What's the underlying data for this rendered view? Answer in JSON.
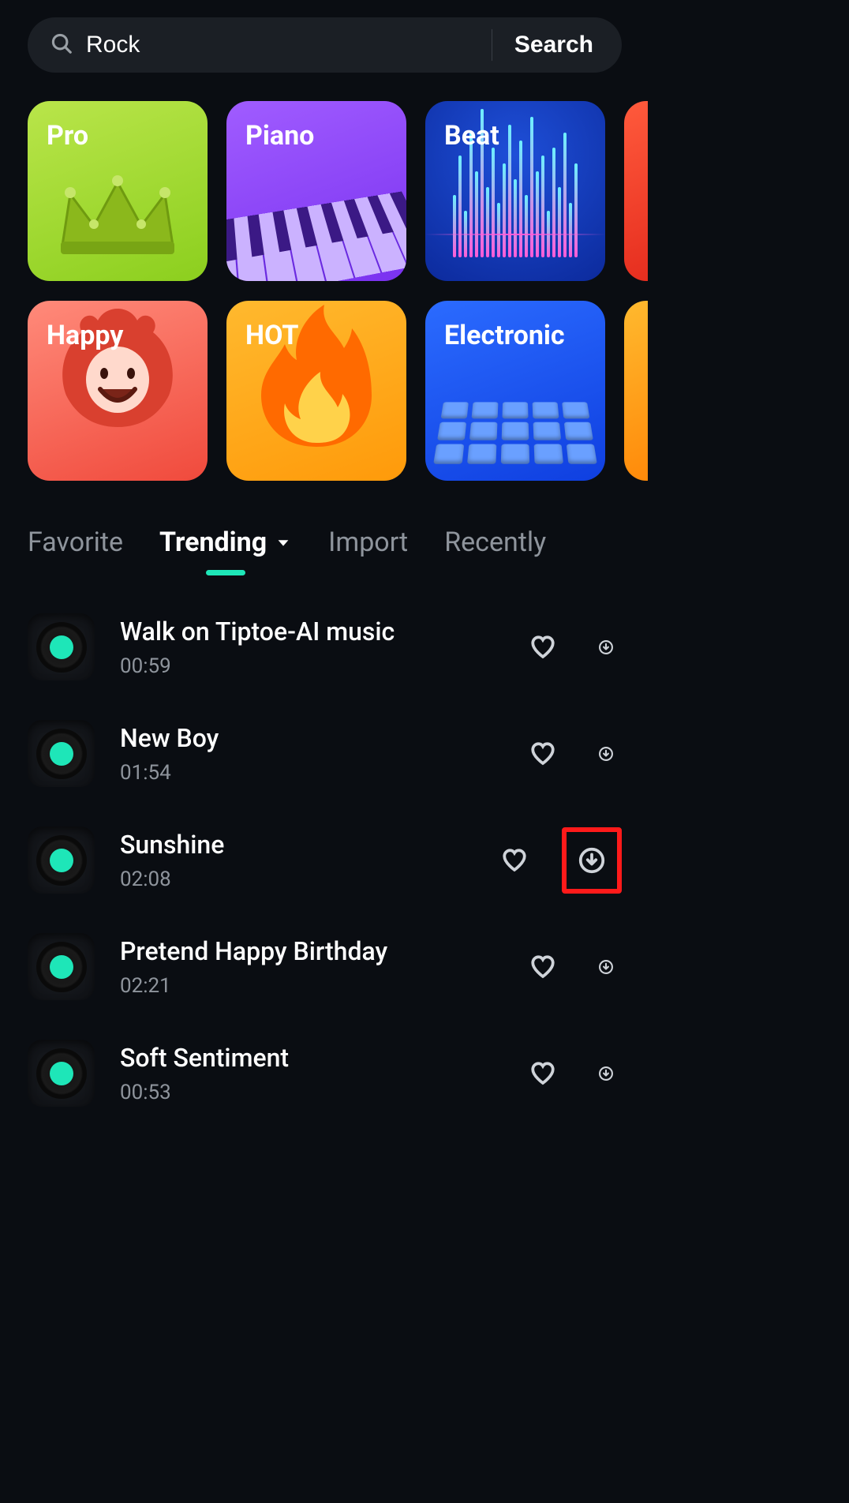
{
  "search": {
    "value": "Rock",
    "button": "Search"
  },
  "categories": {
    "row1": [
      {
        "label": "Pro",
        "key": "pro"
      },
      {
        "label": "Piano",
        "key": "piano"
      },
      {
        "label": "Beat",
        "key": "beat"
      }
    ],
    "row2": [
      {
        "label": "Happy",
        "key": "happy"
      },
      {
        "label": "HOT",
        "key": "hot"
      },
      {
        "label": "Electronic",
        "key": "electronic"
      }
    ]
  },
  "tabs": {
    "items": [
      "Favorite",
      "Trending",
      "Import",
      "Recently"
    ],
    "active": "Trending"
  },
  "tracks": [
    {
      "title": "Walk on Tiptoe-AI music",
      "duration": "00:59",
      "highlighted": false
    },
    {
      "title": "New Boy",
      "duration": "01:54",
      "highlighted": false
    },
    {
      "title": "Sunshine",
      "duration": "02:08",
      "highlighted": true
    },
    {
      "title": "Pretend Happy Birthday",
      "duration": "02:21",
      "highlighted": false
    },
    {
      "title": "Soft Sentiment",
      "duration": "00:53",
      "highlighted": false
    }
  ],
  "icons": {
    "search": "search-icon",
    "dropdown": "caret-down-icon",
    "heart": "heart-icon",
    "download": "download-icon"
  }
}
